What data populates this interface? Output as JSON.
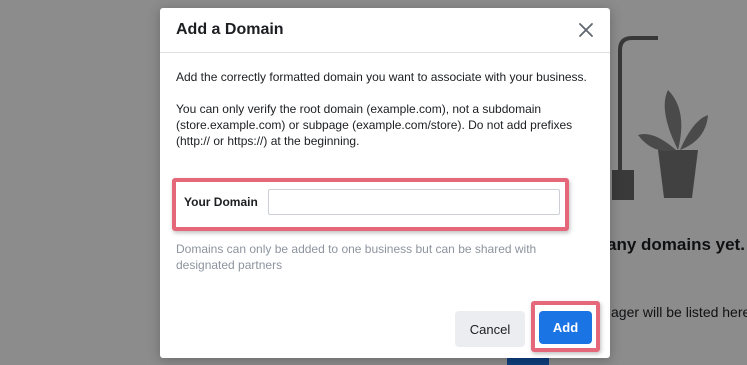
{
  "modal": {
    "title": "Add a Domain",
    "intro": "Add the correctly formatted domain you want to associate with your business.",
    "instructions": "You can only verify the root domain (example.com), not a subdomain (store.example.com) or subpage (example.com/store). Do not add prefixes (http:// or https://) at the beginning.",
    "field_label": "Your Domain",
    "field_value": "",
    "field_placeholder": "",
    "helper_text": "Domains can only be added to one business but can be shared with designated partners",
    "cancel_label": "Cancel",
    "add_label": "Add",
    "close_icon": "close-icon"
  },
  "background": {
    "heading": "any domains yet.",
    "subtext": "ager will be listed here"
  },
  "colors": {
    "accent": "#1b74e4",
    "highlight": "#e5687a",
    "secondary_button": "#ebedf0",
    "helper_text": "#8d949e"
  }
}
